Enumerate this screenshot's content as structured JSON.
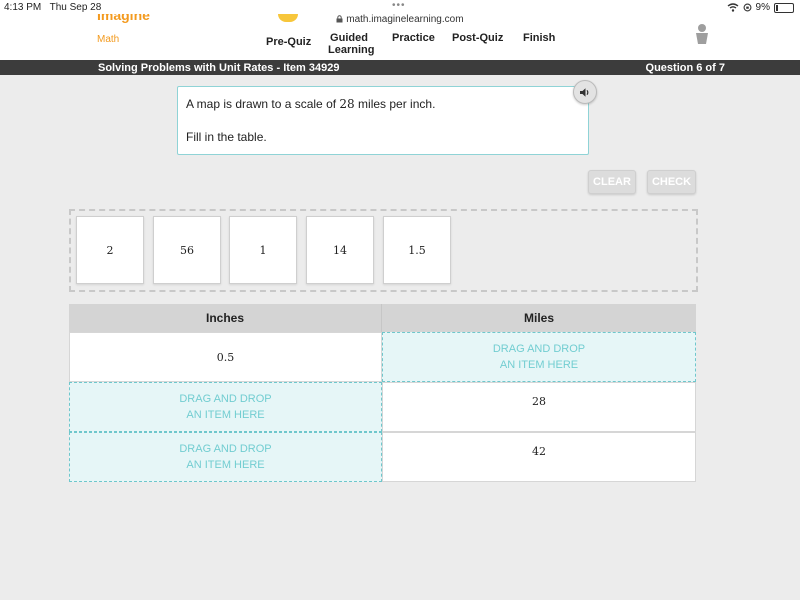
{
  "status": {
    "time": "4:13 PM",
    "date": "Thu Sep 28",
    "battery": "9%",
    "url": "math.imaginelearning.com"
  },
  "brand": {
    "name": "Imagine",
    "sub": "Math",
    "accent": "#f39a1e"
  },
  "nav": {
    "items": [
      "Pre-Quiz",
      "Guided",
      "Learning",
      "Practice",
      "Post-Quiz",
      "Finish"
    ]
  },
  "titlebar": {
    "lesson": "Solving Problems with Unit Rates - Item 34929",
    "progress": "Question 6 of 7"
  },
  "question": {
    "pre": "A map is drawn to a scale of ",
    "num": "28",
    "post": " miles per inch.",
    "instruction": "Fill in the table."
  },
  "buttons": {
    "clear": "CLEAR",
    "check": "CHECK"
  },
  "bank": [
    "2",
    "56",
    "1",
    "14",
    "1.5"
  ],
  "table": {
    "headers": [
      "Inches",
      "Miles"
    ],
    "drop_line1": "DRAG AND DROP",
    "drop_line2": "AN ITEM HERE",
    "r0c0": "0.5",
    "r1c1": "28",
    "r2c1": "42"
  }
}
